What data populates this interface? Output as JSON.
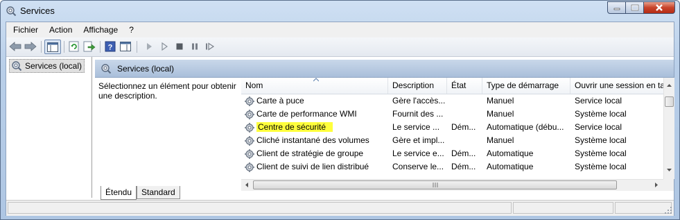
{
  "window": {
    "title": "Services"
  },
  "menu": [
    "Fichier",
    "Action",
    "Affichage",
    "?"
  ],
  "toolbar": [
    "back-icon",
    "forward-icon",
    "show-console-tree-icon",
    "refresh-icon",
    "export-list-icon",
    "help-icon",
    "properties-pane-icon",
    "start-service-icon",
    "start-service-alt-icon",
    "stop-service-icon",
    "pause-service-icon",
    "restart-service-icon"
  ],
  "tree": {
    "root_label": "Services (local)"
  },
  "content": {
    "header_title": "Services (local)",
    "description_prompt": "Sélectionnez un élément pour obtenir une description."
  },
  "columns": [
    "Nom",
    "Description",
    "État",
    "Type de démarrage",
    "Ouvrir une session en ta"
  ],
  "rows": [
    {
      "name": "Carte à puce",
      "description": "Gère l'accès...",
      "state": "",
      "startup": "Manuel",
      "logon": "Service local",
      "highlighted": false
    },
    {
      "name": "Carte de performance WMI",
      "description": "Fournit des ...",
      "state": "",
      "startup": "Manuel",
      "logon": "Système local",
      "highlighted": false
    },
    {
      "name": "Centre de sécurité",
      "description": "Le service ...",
      "state": "Dém...",
      "startup": "Automatique (débu...",
      "logon": "Service local",
      "highlighted": true
    },
    {
      "name": "Cliché instantané des volumes",
      "description": "Gère et impl...",
      "state": "",
      "startup": "Manuel",
      "logon": "Système local",
      "highlighted": false
    },
    {
      "name": "Client de stratégie de groupe",
      "description": "Le service e...",
      "state": "Dém...",
      "startup": "Automatique",
      "logon": "Système local",
      "highlighted": false
    },
    {
      "name": "Client de suivi de lien distribué",
      "description": "Conserve le...",
      "state": "Dém...",
      "startup": "Automatique",
      "logon": "Système local",
      "highlighted": false
    }
  ],
  "tabs": [
    {
      "label": "Étendu",
      "active": true
    },
    {
      "label": "Standard",
      "active": false
    }
  ],
  "colors": {
    "highlight": "#ffff3c",
    "header_band": "#b9cde5",
    "titlebar": "#c1d5ec"
  }
}
